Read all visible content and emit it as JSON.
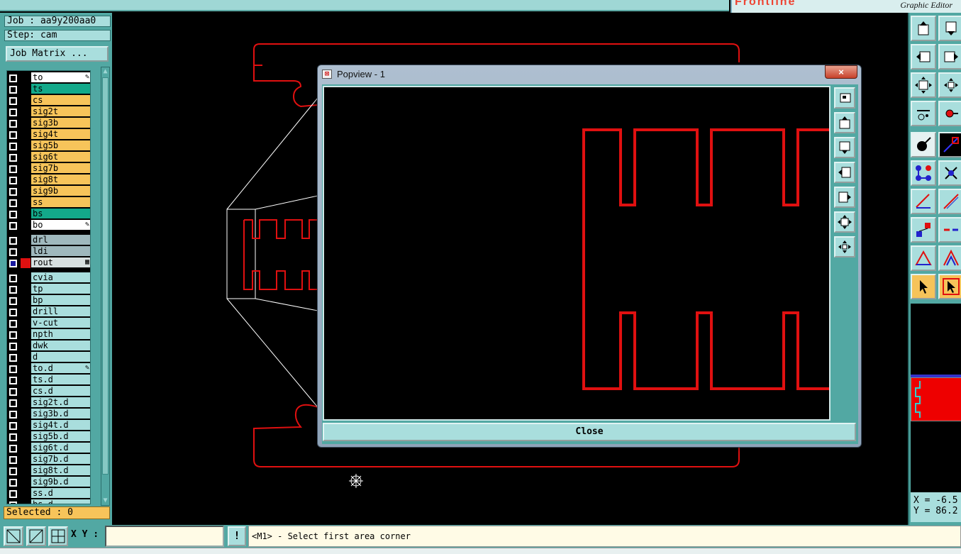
{
  "app": {
    "brand": "Frontline",
    "subtitle": "Graphic Editor"
  },
  "job": {
    "job_label": "Job : aa9y200aa0",
    "step_label": "Step: cam",
    "matrix_button": "Job Matrix ..."
  },
  "layers": [
    {
      "name": "to",
      "color": "#ffffff",
      "flag": "✎"
    },
    {
      "name": "ts",
      "color": "#13a98a"
    },
    {
      "name": "cs",
      "color": "#f7c45a"
    },
    {
      "name": "sig2t",
      "color": "#f7c45a"
    },
    {
      "name": "sig3b",
      "color": "#f7c45a"
    },
    {
      "name": "sig4t",
      "color": "#f7c45a"
    },
    {
      "name": "sig5b",
      "color": "#f7c45a"
    },
    {
      "name": "sig6t",
      "color": "#f7c45a"
    },
    {
      "name": "sig7b",
      "color": "#f7c45a"
    },
    {
      "name": "sig8t",
      "color": "#f7c45a"
    },
    {
      "name": "sig9b",
      "color": "#f7c45a"
    },
    {
      "name": "ss",
      "color": "#f7c45a"
    },
    {
      "name": "bs",
      "color": "#13a98a"
    },
    {
      "name": "bo",
      "color": "#ffffff",
      "flag": "✎"
    },
    {
      "name": "drl",
      "color": "#9fb8bd"
    },
    {
      "name": "ldi",
      "color": "#9fb8bd"
    },
    {
      "name": "rout",
      "color": "#d8e0e0",
      "active": true,
      "flag": "▦"
    },
    {
      "name": "cvia",
      "color": "#a9dedd"
    },
    {
      "name": "tp",
      "color": "#a9dedd"
    },
    {
      "name": "bp",
      "color": "#a9dedd"
    },
    {
      "name": "drill",
      "color": "#a9dedd"
    },
    {
      "name": "v-cut",
      "color": "#a9dedd"
    },
    {
      "name": "npth",
      "color": "#a9dedd"
    },
    {
      "name": "dwk",
      "color": "#a9dedd"
    },
    {
      "name": "d",
      "color": "#a9dedd"
    },
    {
      "name": "to.d",
      "color": "#a9dedd",
      "flag": "✎"
    },
    {
      "name": "ts.d",
      "color": "#a9dedd"
    },
    {
      "name": "cs.d",
      "color": "#a9dedd"
    },
    {
      "name": "sig2t.d",
      "color": "#a9dedd"
    },
    {
      "name": "sig3b.d",
      "color": "#a9dedd"
    },
    {
      "name": "sig4t.d",
      "color": "#a9dedd"
    },
    {
      "name": "sig5b.d",
      "color": "#a9dedd"
    },
    {
      "name": "sig6t.d",
      "color": "#a9dedd"
    },
    {
      "name": "sig7b.d",
      "color": "#a9dedd"
    },
    {
      "name": "sig8t.d",
      "color": "#a9dedd"
    },
    {
      "name": "sig9b.d",
      "color": "#a9dedd"
    },
    {
      "name": "ss.d",
      "color": "#a9dedd"
    },
    {
      "name": "bs.d",
      "color": "#a9dedd"
    }
  ],
  "selected_label": "Selected : 0",
  "popview": {
    "title": "Popview - 1",
    "close_x": "×",
    "close_button": "Close"
  },
  "coords": {
    "x": "X = -6.5",
    "y": "Y = 86.2"
  },
  "bottom": {
    "xy_label": "X Y :",
    "xy_value": "",
    "exclaim": "!",
    "status": "<M1> - Select first area corner"
  },
  "colors": {
    "panel": "#52a8a3",
    "panel_light": "#a9dedd",
    "outline": "#e01010",
    "highlight": "#f7c45a"
  }
}
